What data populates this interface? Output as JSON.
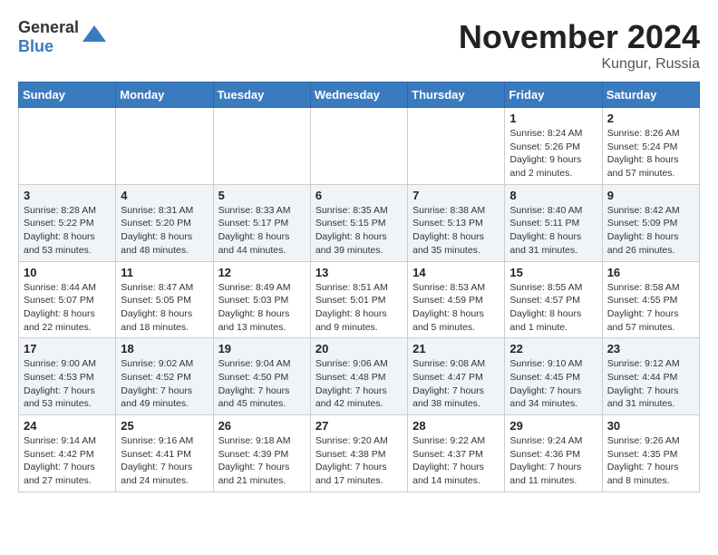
{
  "logo": {
    "text_general": "General",
    "text_blue": "Blue"
  },
  "title": "November 2024",
  "subtitle": "Kungur, Russia",
  "days_of_week": [
    "Sunday",
    "Monday",
    "Tuesday",
    "Wednesday",
    "Thursday",
    "Friday",
    "Saturday"
  ],
  "weeks": [
    [
      {
        "day": "",
        "info": ""
      },
      {
        "day": "",
        "info": ""
      },
      {
        "day": "",
        "info": ""
      },
      {
        "day": "",
        "info": ""
      },
      {
        "day": "",
        "info": ""
      },
      {
        "day": "1",
        "info": "Sunrise: 8:24 AM\nSunset: 5:26 PM\nDaylight: 9 hours\nand 2 minutes."
      },
      {
        "day": "2",
        "info": "Sunrise: 8:26 AM\nSunset: 5:24 PM\nDaylight: 8 hours\nand 57 minutes."
      }
    ],
    [
      {
        "day": "3",
        "info": "Sunrise: 8:28 AM\nSunset: 5:22 PM\nDaylight: 8 hours\nand 53 minutes."
      },
      {
        "day": "4",
        "info": "Sunrise: 8:31 AM\nSunset: 5:20 PM\nDaylight: 8 hours\nand 48 minutes."
      },
      {
        "day": "5",
        "info": "Sunrise: 8:33 AM\nSunset: 5:17 PM\nDaylight: 8 hours\nand 44 minutes."
      },
      {
        "day": "6",
        "info": "Sunrise: 8:35 AM\nSunset: 5:15 PM\nDaylight: 8 hours\nand 39 minutes."
      },
      {
        "day": "7",
        "info": "Sunrise: 8:38 AM\nSunset: 5:13 PM\nDaylight: 8 hours\nand 35 minutes."
      },
      {
        "day": "8",
        "info": "Sunrise: 8:40 AM\nSunset: 5:11 PM\nDaylight: 8 hours\nand 31 minutes."
      },
      {
        "day": "9",
        "info": "Sunrise: 8:42 AM\nSunset: 5:09 PM\nDaylight: 8 hours\nand 26 minutes."
      }
    ],
    [
      {
        "day": "10",
        "info": "Sunrise: 8:44 AM\nSunset: 5:07 PM\nDaylight: 8 hours\nand 22 minutes."
      },
      {
        "day": "11",
        "info": "Sunrise: 8:47 AM\nSunset: 5:05 PM\nDaylight: 8 hours\nand 18 minutes."
      },
      {
        "day": "12",
        "info": "Sunrise: 8:49 AM\nSunset: 5:03 PM\nDaylight: 8 hours\nand 13 minutes."
      },
      {
        "day": "13",
        "info": "Sunrise: 8:51 AM\nSunset: 5:01 PM\nDaylight: 8 hours\nand 9 minutes."
      },
      {
        "day": "14",
        "info": "Sunrise: 8:53 AM\nSunset: 4:59 PM\nDaylight: 8 hours\nand 5 minutes."
      },
      {
        "day": "15",
        "info": "Sunrise: 8:55 AM\nSunset: 4:57 PM\nDaylight: 8 hours\nand 1 minute."
      },
      {
        "day": "16",
        "info": "Sunrise: 8:58 AM\nSunset: 4:55 PM\nDaylight: 7 hours\nand 57 minutes."
      }
    ],
    [
      {
        "day": "17",
        "info": "Sunrise: 9:00 AM\nSunset: 4:53 PM\nDaylight: 7 hours\nand 53 minutes."
      },
      {
        "day": "18",
        "info": "Sunrise: 9:02 AM\nSunset: 4:52 PM\nDaylight: 7 hours\nand 49 minutes."
      },
      {
        "day": "19",
        "info": "Sunrise: 9:04 AM\nSunset: 4:50 PM\nDaylight: 7 hours\nand 45 minutes."
      },
      {
        "day": "20",
        "info": "Sunrise: 9:06 AM\nSunset: 4:48 PM\nDaylight: 7 hours\nand 42 minutes."
      },
      {
        "day": "21",
        "info": "Sunrise: 9:08 AM\nSunset: 4:47 PM\nDaylight: 7 hours\nand 38 minutes."
      },
      {
        "day": "22",
        "info": "Sunrise: 9:10 AM\nSunset: 4:45 PM\nDaylight: 7 hours\nand 34 minutes."
      },
      {
        "day": "23",
        "info": "Sunrise: 9:12 AM\nSunset: 4:44 PM\nDaylight: 7 hours\nand 31 minutes."
      }
    ],
    [
      {
        "day": "24",
        "info": "Sunrise: 9:14 AM\nSunset: 4:42 PM\nDaylight: 7 hours\nand 27 minutes."
      },
      {
        "day": "25",
        "info": "Sunrise: 9:16 AM\nSunset: 4:41 PM\nDaylight: 7 hours\nand 24 minutes."
      },
      {
        "day": "26",
        "info": "Sunrise: 9:18 AM\nSunset: 4:39 PM\nDaylight: 7 hours\nand 21 minutes."
      },
      {
        "day": "27",
        "info": "Sunrise: 9:20 AM\nSunset: 4:38 PM\nDaylight: 7 hours\nand 17 minutes."
      },
      {
        "day": "28",
        "info": "Sunrise: 9:22 AM\nSunset: 4:37 PM\nDaylight: 7 hours\nand 14 minutes."
      },
      {
        "day": "29",
        "info": "Sunrise: 9:24 AM\nSunset: 4:36 PM\nDaylight: 7 hours\nand 11 minutes."
      },
      {
        "day": "30",
        "info": "Sunrise: 9:26 AM\nSunset: 4:35 PM\nDaylight: 7 hours\nand 8 minutes."
      }
    ]
  ]
}
